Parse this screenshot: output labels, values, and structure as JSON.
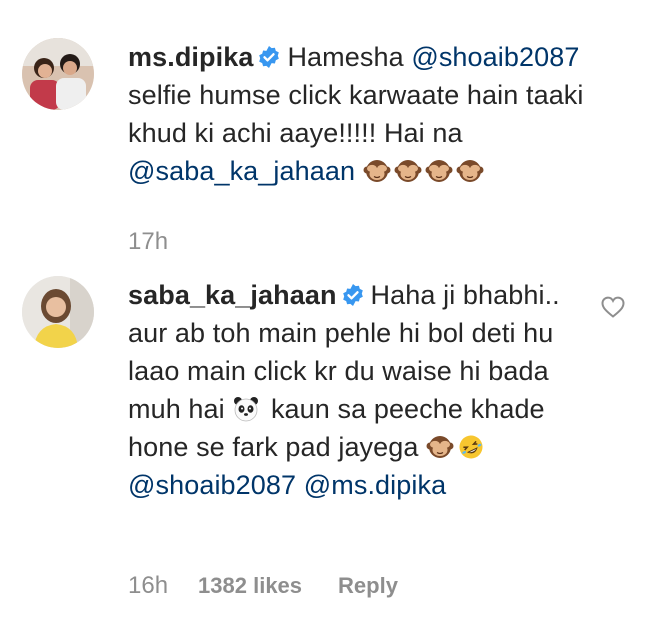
{
  "comments": [
    {
      "username": "ms.dipika",
      "verified": true,
      "parts": [
        {
          "kind": "text",
          "value": "Hamesha "
        },
        {
          "kind": "mention",
          "value": "@shoaib2087"
        },
        {
          "kind": "text",
          "value": " selfie humse click karwaate hain taaki khud ki achi aaye!!!!! Hai na "
        },
        {
          "kind": "mention",
          "value": "@saba_ka_jahaan"
        },
        {
          "kind": "text",
          "value": " "
        },
        {
          "kind": "emoji",
          "value": "see-no-evil-monkey-icon"
        },
        {
          "kind": "emoji",
          "value": "see-no-evil-monkey-icon"
        },
        {
          "kind": "emoji",
          "value": "see-no-evil-monkey-icon"
        },
        {
          "kind": "emoji",
          "value": "see-no-evil-monkey-icon"
        }
      ],
      "time": "17h",
      "likes": "",
      "reply_label": ""
    },
    {
      "username": "saba_ka_jahaan",
      "verified": true,
      "parts": [
        {
          "kind": "text",
          "value": "Haha ji bhabhi.. aur ab toh main pehle hi bol deti hu laao main click kr du waise hi bada muh hai "
        },
        {
          "kind": "emoji",
          "value": "panda-icon"
        },
        {
          "kind": "text",
          "value": " kaun sa peeche khade hone se fark pad jayega "
        },
        {
          "kind": "emoji",
          "value": "see-no-evil-monkey-icon"
        },
        {
          "kind": "emoji",
          "value": "rolling-on-floor-laughing-icon"
        },
        {
          "kind": "text",
          "value": " "
        },
        {
          "kind": "mention",
          "value": "@shoaib2087"
        },
        {
          "kind": "text",
          "value": " "
        },
        {
          "kind": "mention",
          "value": "@ms.dipika"
        }
      ],
      "time": "16h",
      "likes": "1382 likes",
      "reply_label": "Reply"
    }
  ],
  "icons": {
    "verified": "verified-badge-icon",
    "like": "heart-outline-icon"
  },
  "colors": {
    "text": "#262626",
    "mention": "#003569",
    "meta": "#8e8e8e",
    "verified": "#3897f0"
  }
}
